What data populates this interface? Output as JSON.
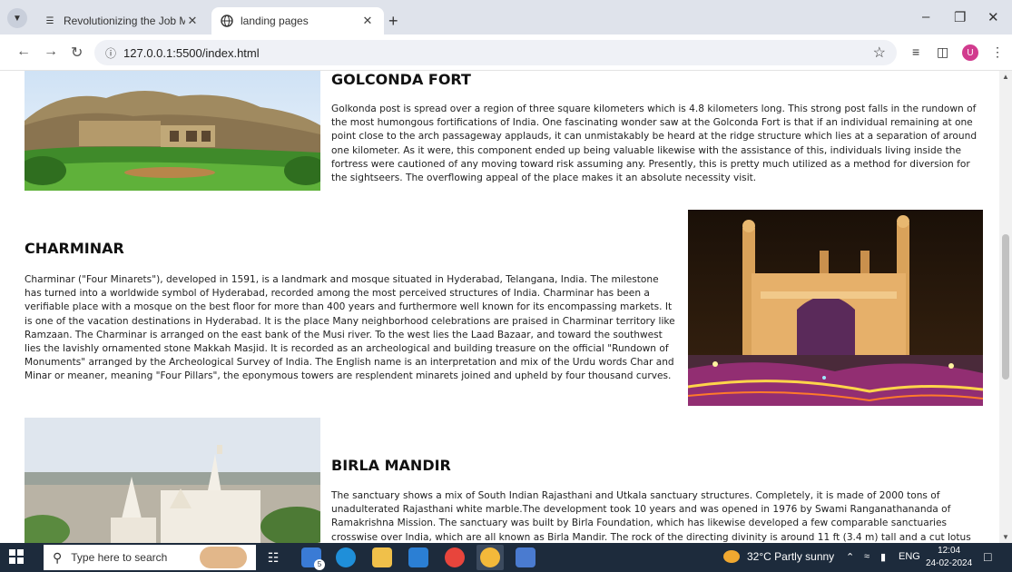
{
  "browser": {
    "tabs": [
      {
        "title": "Revolutionizing the Job Market",
        "active": false
      },
      {
        "title": "landing pages",
        "active": true
      }
    ],
    "url": "127.0.0.1:5500/index.html",
    "profile_initial": "U"
  },
  "sections": [
    {
      "heading": "GOLCONDA FORT",
      "body": "Golkonda post is spread over a region of three square kilometers which is 4.8 kilometers long. This strong post falls in the rundown of the most humongous fortifications of India. One fascinating wonder saw at the Golconda Fort is that if an individual remaining at one point close to the arch passageway applauds, it can unmistakably be heard at the ridge structure which lies at a separation of around one kilometer. As it were, this component ended up being valuable likewise with the assistance of this, individuals living inside the fortress were cautioned of any moving toward risk assuming any. Presently, this is pretty much utilized as a method for diversion for the sightseers. The overflowing appeal of the place makes it an absolute necessity visit."
    },
    {
      "heading": "CHARMINAR",
      "body": "Charminar (\"Four Minarets\"), developed in 1591, is a landmark and mosque situated in Hyderabad, Telangana, India. The milestone has turned into a worldwide symbol of Hyderabad, recorded among the most perceived structures of India. Charminar has been a verifiable place with a mosque on the best floor for more than 400 years and furthermore well known for its encompassing markets. It is one of the vacation destinations in Hyderabad. It is the place Many neighborhood celebrations are praised in Charminar territory like Ramzaan. The Charminar is arranged on the east bank of the Musi river. To the west lies the Laad Bazaar, and toward the southwest lies the lavishly ornamented stone Makkah Masjid. It is recorded as an archeological and building treasure on the official \"Rundown of Monuments\" arranged by the Archeological Survey of India. The English name is an interpretation and mix of the Urdu words Char and Minar or meaner, meaning \"Four Pillars\", the eponymous towers are resplendent minarets joined and upheld by four thousand curves."
    },
    {
      "heading": "BIRLA MANDIR",
      "body": "The sanctuary shows a mix of South Indian Rajasthani and Utkala sanctuary structures. Completely, it is made of 2000 tons of unadulterated Rajasthani white marble.The development took 10 years and was opened in 1976 by Swami Ranganathananda of Ramakrishna Mission. The sanctuary was built by Birla Foundation, which has likewise developed a few comparable sanctuaries crosswise over India, which are all known as Birla Mandir. The rock of the directing divinity is around 11 ft (3.4 m) tall and a cut lotus"
    }
  ],
  "taskbar": {
    "search_placeholder": "Type here to search",
    "mail_badge": "5",
    "weather": "32°C  Partly sunny",
    "language": "ENG",
    "time": "12:04",
    "date": "24-02-2024"
  }
}
